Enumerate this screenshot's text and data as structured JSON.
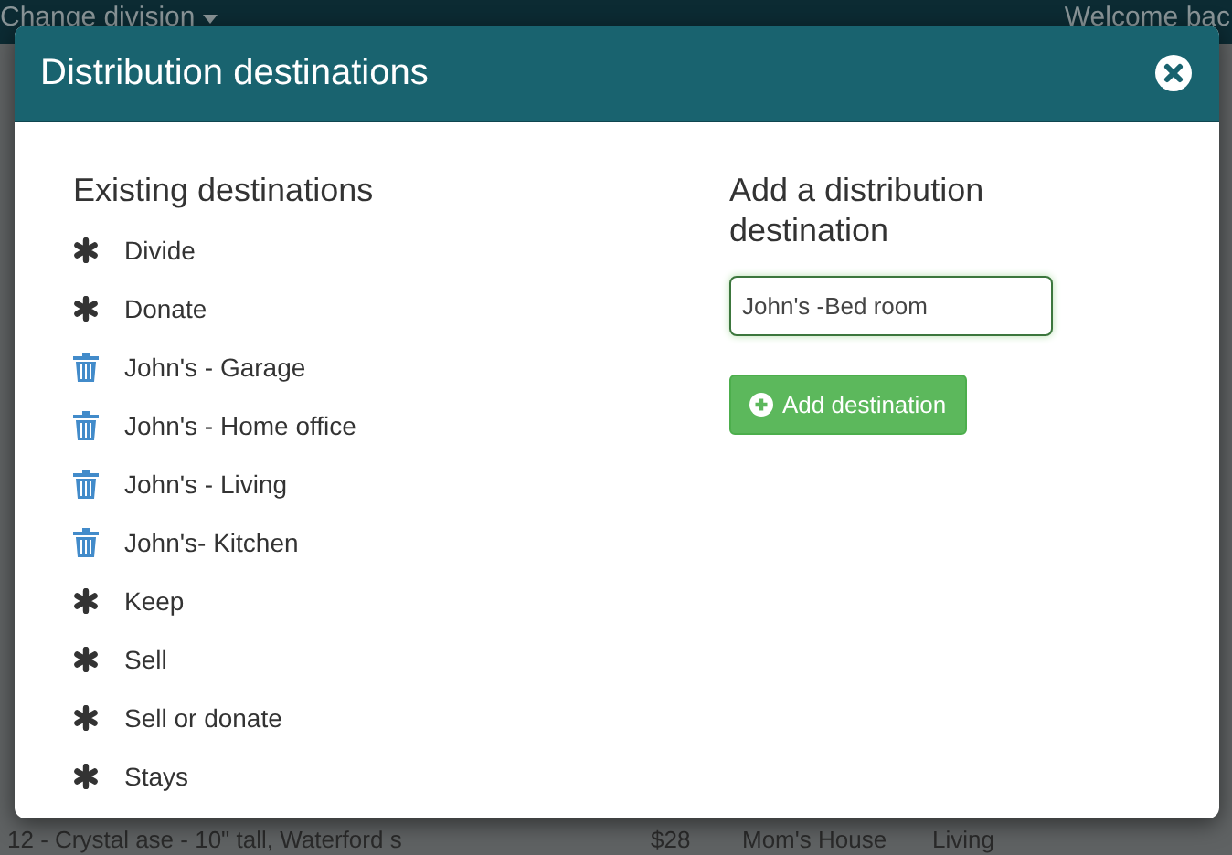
{
  "topbar": {
    "division_menu": "Change division",
    "welcome": "Welcome bac"
  },
  "background_row": {
    "column_1": "12 - Crystal ase - 10\" tall, Waterford s",
    "column_2": "$28",
    "column_3": "Mom's House",
    "column_4": "Living"
  },
  "dialog": {
    "title": "Distribution destinations",
    "existing": {
      "heading": "Existing destinations",
      "items": [
        {
          "label": "Divide",
          "kind": "asterisk"
        },
        {
          "label": "Donate",
          "kind": "asterisk"
        },
        {
          "label": "John's - Garage",
          "kind": "trash"
        },
        {
          "label": "John's - Home office",
          "kind": "trash"
        },
        {
          "label": "John's - Living",
          "kind": "trash"
        },
        {
          "label": "John's- Kitchen",
          "kind": "trash"
        },
        {
          "label": "Keep",
          "kind": "asterisk"
        },
        {
          "label": "Sell",
          "kind": "asterisk"
        },
        {
          "label": "Sell or donate",
          "kind": "asterisk"
        },
        {
          "label": "Stays",
          "kind": "asterisk"
        }
      ]
    },
    "add": {
      "heading": "Add a distribution destination",
      "field_value": "John's -Bed room",
      "button": "Add destination"
    }
  }
}
